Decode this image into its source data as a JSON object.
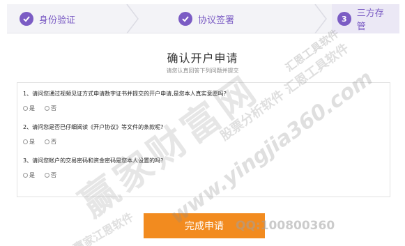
{
  "steps": [
    {
      "num": "✓",
      "label": "身份验证",
      "state": "done"
    },
    {
      "num": "✓",
      "label": "协议签署",
      "state": "done"
    },
    {
      "num": "3",
      "label": "三方存管",
      "state": "current"
    }
  ],
  "header": {
    "title": "确认开户申请",
    "subtitle": "请您认真回答下列问题并提交"
  },
  "questions": [
    {
      "text": "1、请问您通过视频见证方式申请数字证书并提交的开户申请,是您本人真实意愿吗?",
      "options": [
        "是",
        "否"
      ]
    },
    {
      "text": "2、请问您是否已仔细阅读《开户协议》等文件的条款呢?",
      "options": [
        "是",
        "否"
      ]
    },
    {
      "text": "3、请问您帐户的交易密码和资金密码是您本人设置的吗?",
      "options": [
        "是",
        "否"
      ]
    }
  ],
  "submit": {
    "label": "完成申请"
  },
  "watermarks": {
    "big": "赢家财富网",
    "site": "www.yingjia360.com",
    "mid": "股票分析软件 汇恩工具软件",
    "small": "赢家江恩软件",
    "qq": "QQ:100800360",
    "corner": "汇恩工具软件"
  },
  "colors": {
    "accent": "#7b5cc4",
    "button": "#f28b1f"
  }
}
